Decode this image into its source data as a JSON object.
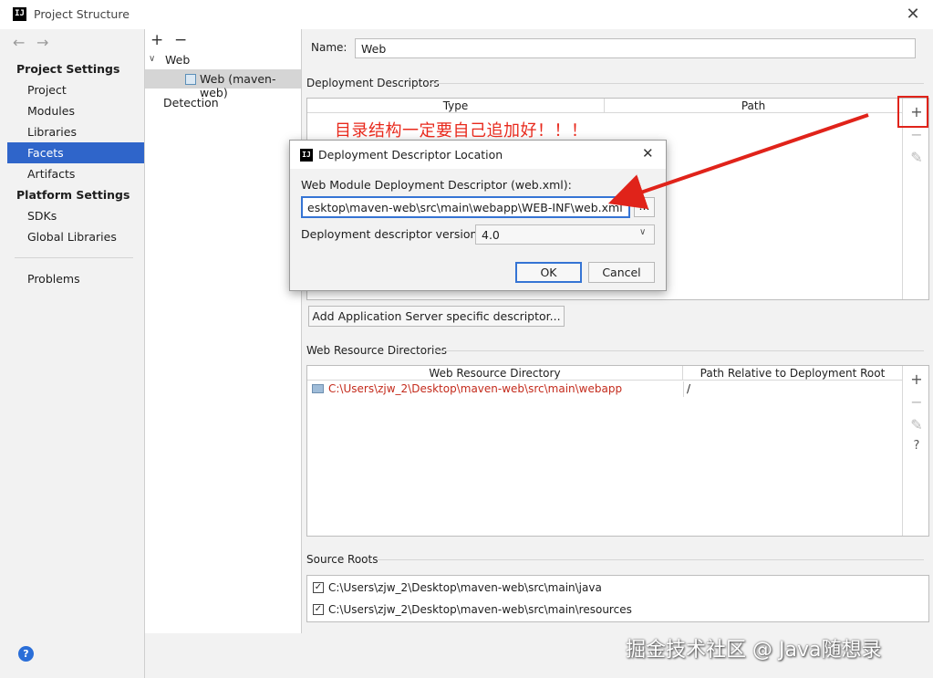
{
  "window": {
    "title": "Project Structure",
    "logo": "IJ",
    "close": "✕"
  },
  "nav": {
    "back": "←",
    "forward": "→"
  },
  "sidebar": {
    "project_settings_header": "Project Settings",
    "project_items": [
      "Project",
      "Modules",
      "Libraries",
      "Facets",
      "Artifacts"
    ],
    "platform_settings_header": "Platform Settings",
    "platform_items": [
      "SDKs",
      "Global Libraries"
    ],
    "other_items": [
      "Problems"
    ],
    "selected": "Facets",
    "help": "?"
  },
  "tree": {
    "add": "+",
    "remove": "−",
    "root": "Web",
    "child": "Web (maven-web)",
    "detection": "Detection"
  },
  "facet": {
    "name_label": "Name:",
    "name_value": "Web",
    "deployment_descriptors_label": "Deployment Descriptors",
    "dd_columns": [
      "Type",
      "Path"
    ],
    "add_server_descriptor_button": "Add Application Server specific descriptor...",
    "web_resource_dirs_label": "Web Resource Directories",
    "wr_columns": [
      "Web Resource Directory",
      "Path Relative to Deployment Root"
    ],
    "wr_rows": [
      {
        "directory": "C:\\Users\\zjw_2\\Desktop\\maven-web\\src\\main\\webapp",
        "relative": "/"
      }
    ],
    "source_roots_label": "Source Roots",
    "source_roots": [
      "C:\\Users\\zjw_2\\Desktop\\maven-web\\src\\main\\java",
      "C:\\Users\\zjw_2\\Desktop\\maven-web\\src\\main\\resources"
    ]
  },
  "toolbar": {
    "add": "+",
    "remove": "−",
    "edit": "✎",
    "help": "?"
  },
  "dialog": {
    "title": "Deployment Descriptor Location",
    "descriptor_label": "Web Module Deployment Descriptor (web.xml):",
    "descriptor_value": "esktop\\maven-web\\src\\main\\webapp\\WEB-INF\\web.xml",
    "browse": "...",
    "version_label": "Deployment descriptor version",
    "version_value": "4.0",
    "ok": "OK",
    "cancel": "Cancel"
  },
  "annotation": {
    "text": "目录结构一定要自己追加好！！！",
    "color": "#e8291c"
  },
  "watermark": "掘金技术社区 @ Java随想录",
  "colors": {
    "selection": "#2f65ca",
    "annotation": "#e0231a",
    "path_red": "#c0392b"
  }
}
